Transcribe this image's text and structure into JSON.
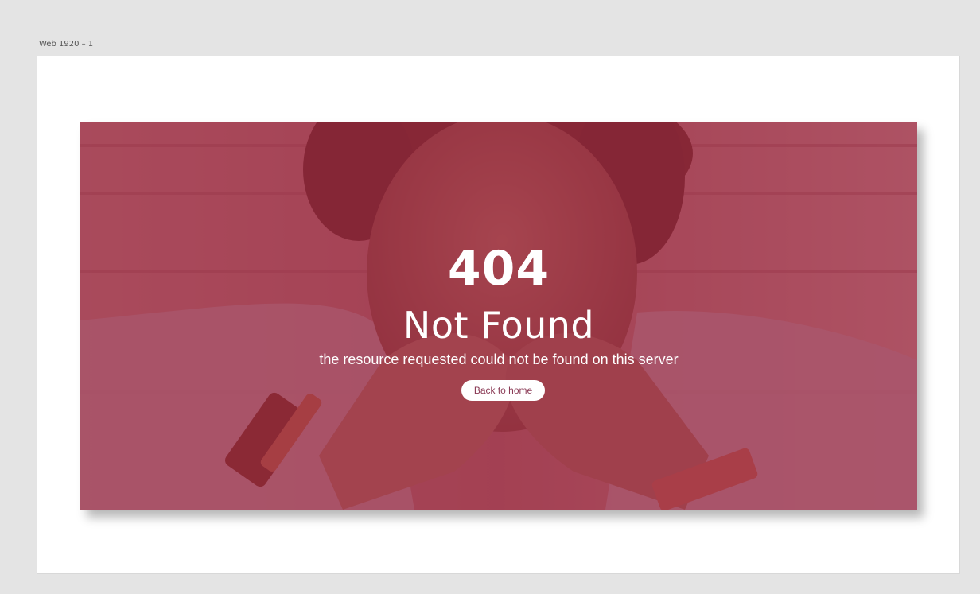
{
  "artboard": {
    "label": "Web 1920 – 1"
  },
  "error_page": {
    "code": "404",
    "title": "Not Found",
    "message": "the resource requested could not be found on this server",
    "back_button_label": "Back to home"
  },
  "colors": {
    "canvas_background": "#e4e4e4",
    "artboard_background": "#ffffff",
    "overlay_tint": "#96233e",
    "text": "#ffffff",
    "button_background": "#ffffff",
    "button_text": "#8a3a55"
  }
}
